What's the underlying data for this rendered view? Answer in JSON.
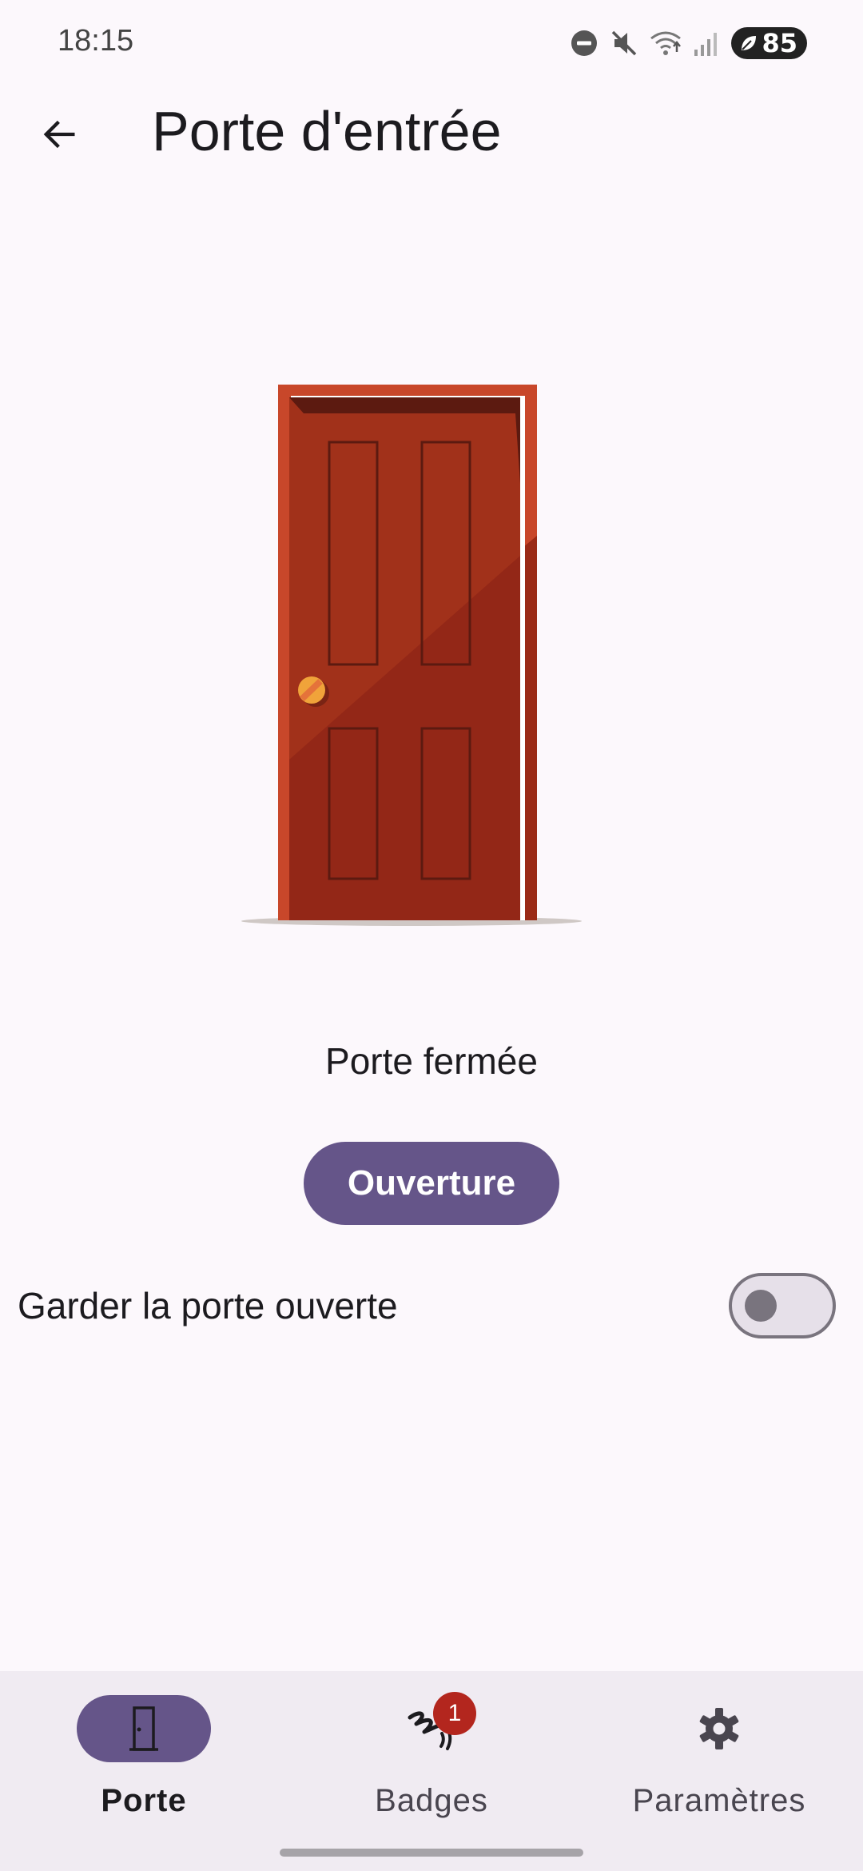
{
  "status_bar": {
    "time": "18:15",
    "battery_level": "85",
    "icons": [
      "do-not-disturb-icon",
      "mute-icon",
      "wifi-icon",
      "signal-icon",
      "battery-icon"
    ]
  },
  "app_bar": {
    "title": "Porte d'entrée",
    "back_icon": "arrow-back-icon"
  },
  "door": {
    "status_text": "Porte fermée",
    "open_button_label": "Ouverture",
    "colors": {
      "frame": "#c8472a",
      "door": "#a1311a",
      "knob": "#f0a33a",
      "panel_outline": "#5c1a10"
    }
  },
  "keep_open": {
    "label": "Garder la porte ouverte",
    "enabled": false
  },
  "bottom_nav": {
    "items": [
      {
        "label": "Porte",
        "icon": "door-icon",
        "active": true
      },
      {
        "label": "Badges",
        "icon": "nfc-icon",
        "badge": "1",
        "active": false
      },
      {
        "label": "Paramètres",
        "icon": "gear-icon",
        "active": false
      }
    ]
  },
  "theme": {
    "primary": "#655589",
    "background": "#fcf8fc",
    "nav_background": "#f0ebf2",
    "badge": "#b3261e"
  }
}
